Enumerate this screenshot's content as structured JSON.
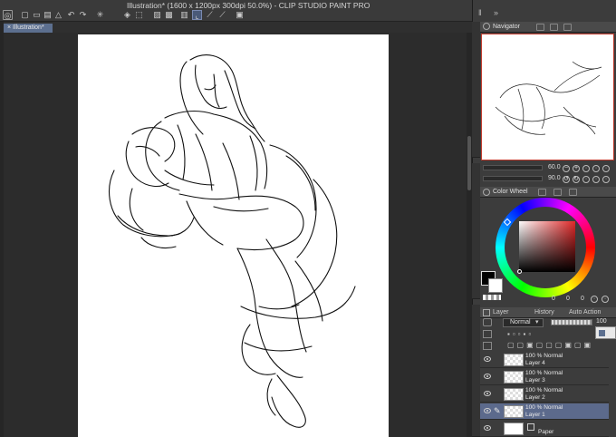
{
  "window": {
    "title": "Illustration* (1600 x 1200px 300dpi 50.0%)  - CLIP STUDIO PAINT PRO"
  },
  "document_tab": {
    "label": "Illustration*"
  },
  "navigator": {
    "title": "Navigator",
    "zoom_value": "60.0",
    "rotation_value": "90.0"
  },
  "color_wheel": {
    "title": "Color Wheel",
    "values": [
      "0",
      "0",
      "0"
    ],
    "main_color": "#000000",
    "sub_color": "#ffffff"
  },
  "layer_panel": {
    "tabs": [
      "Layer",
      "History",
      "Auto Action"
    ],
    "blend_mode": "Normal",
    "opacity": "100",
    "layers": [
      {
        "mode": "100 % Normal",
        "name": "Layer 4",
        "active": false
      },
      {
        "mode": "100 % Normal",
        "name": "Layer 3",
        "active": false
      },
      {
        "mode": "100 % Normal",
        "name": "Layer 2",
        "active": false
      },
      {
        "mode": "100 % Normal",
        "name": "Layer 1",
        "active": true
      },
      {
        "mode": "",
        "name": "Paper",
        "active": false
      }
    ]
  },
  "colors": {
    "accent": "#5c6f8f",
    "active_layer": "#5c6a8c",
    "navigator_frame": "#c0392b"
  }
}
